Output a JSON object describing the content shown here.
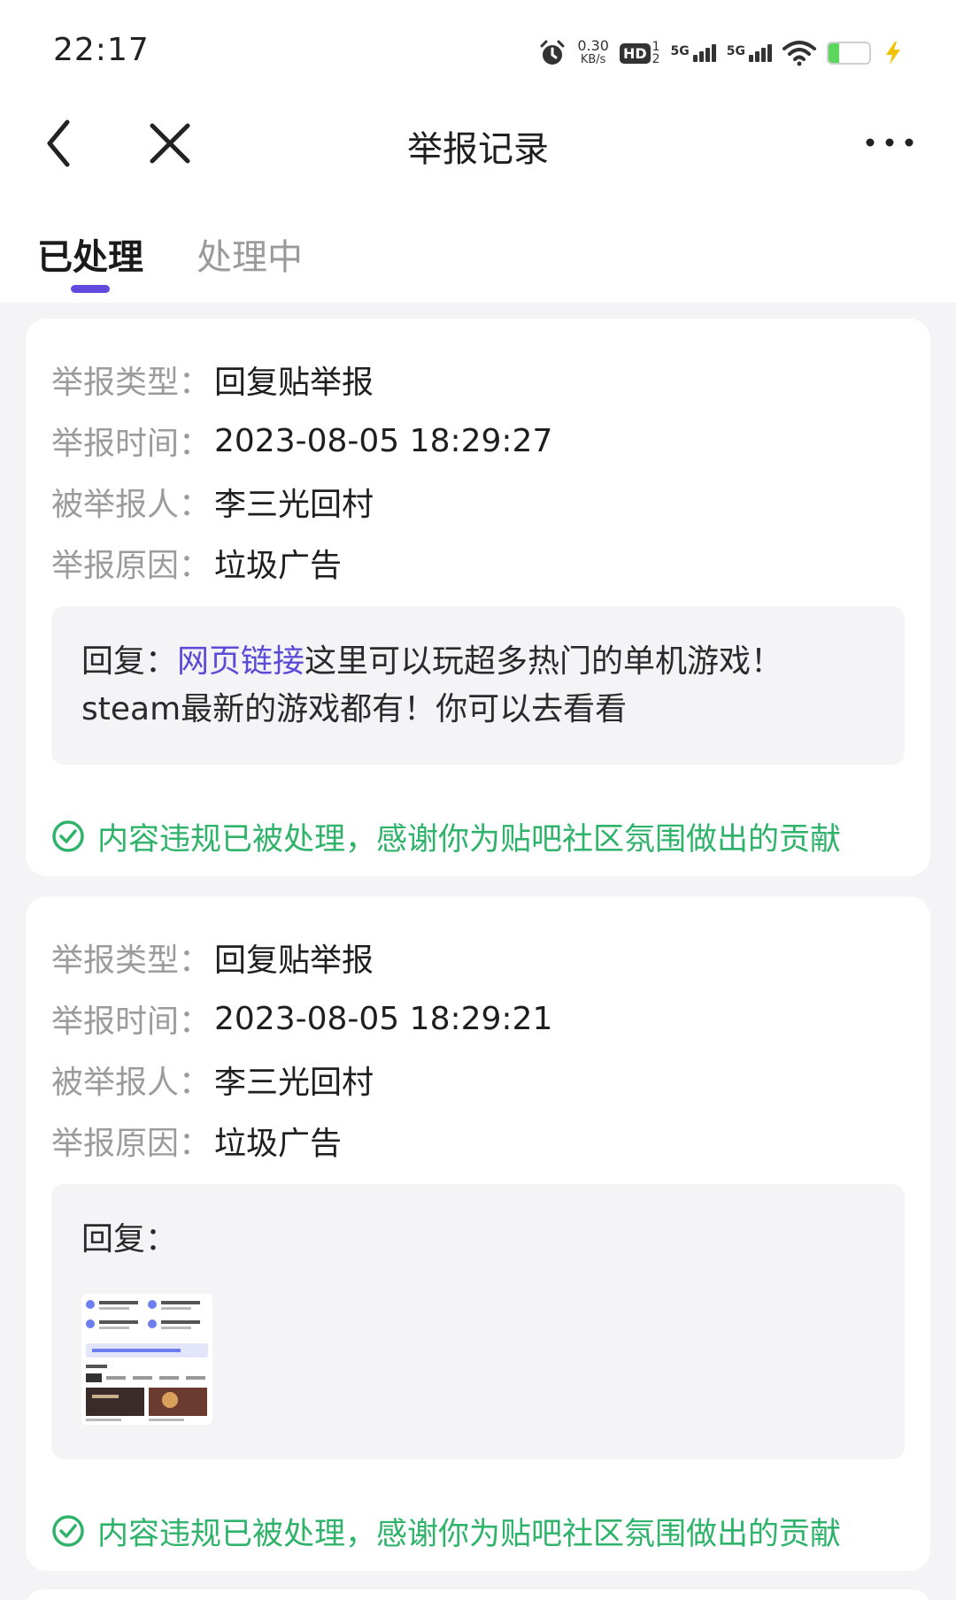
{
  "status_bar": {
    "time": "22:17",
    "speed_value": "0.30",
    "speed_unit": "KB/s",
    "hd_label": "HD",
    "hd_sub_top": "1",
    "hd_sub_bottom": "2",
    "sim1_label": "5G",
    "sim2_label": "5G",
    "battery_level": "25",
    "icons": [
      "alarm-icon",
      "hd-icon",
      "signal-icon",
      "signal-icon",
      "wifi-icon",
      "battery-icon",
      "charging-icon"
    ]
  },
  "header": {
    "title": "举报记录",
    "back_icon": "chevron-left-icon",
    "close_icon": "close-icon",
    "more_icon": "more-icon"
  },
  "tabs": [
    {
      "label": "已处理",
      "active": true
    },
    {
      "label": "处理中",
      "active": false
    }
  ],
  "labels": {
    "type": "举报类型：",
    "time": "举报时间：",
    "target": "被举报人：",
    "reason": "举报原因："
  },
  "colors": {
    "accent": "#614bdf",
    "link": "#5b4bd6",
    "success": "#2fb36a",
    "label_gray": "#9b9b9b",
    "page_bg": "#f4f4f6"
  },
  "reports": [
    {
      "type": "回复贴举报",
      "time": "2023-08-05 18:29:27",
      "target": "李三光回村",
      "reason": "垃圾广告",
      "reply_prefix": "回复：",
      "reply_link": "网页链接",
      "reply_text": "这里可以玩超多热门的单机游戏！steam最新的游戏都有！你可以去看看",
      "status": "内容违规已被处理，感谢你为贴吧社区氛围做出的贡献"
    },
    {
      "type": "回复贴举报",
      "time": "2023-08-05 18:29:21",
      "target": "李三光回村",
      "reason": "垃圾广告",
      "reply_prefix": "回复：",
      "status": "内容违规已被处理，感谢你为贴吧社区氛围做出的贡献"
    }
  ]
}
